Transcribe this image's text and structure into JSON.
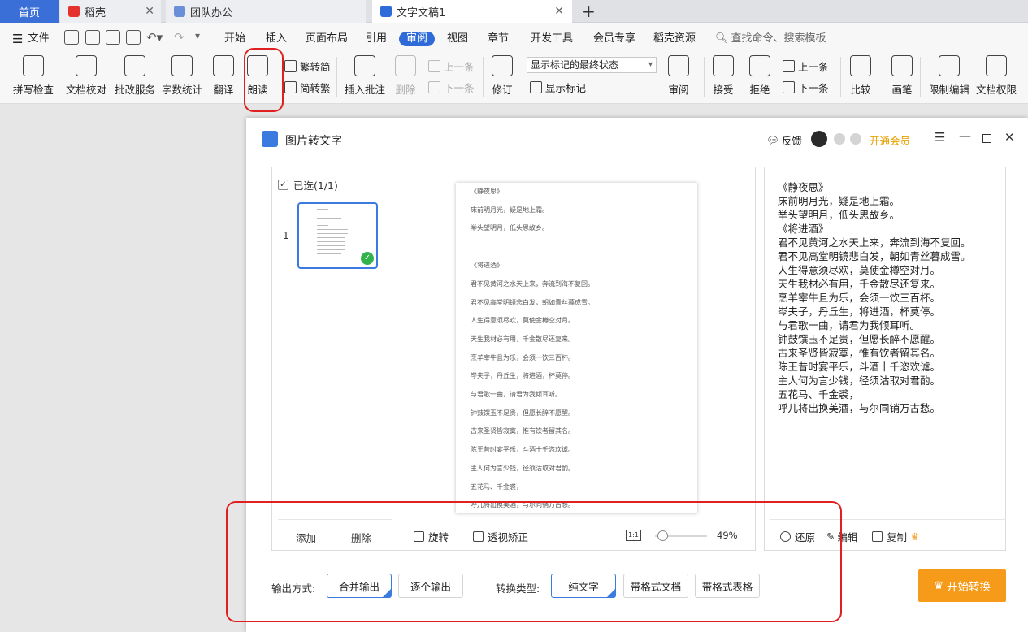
{
  "tabs": [
    {
      "label": "首页"
    },
    {
      "label": "稻壳"
    },
    {
      "label": "团队办公"
    },
    {
      "label": "文字文稿1"
    }
  ],
  "menu": {
    "file": "文件",
    "items": [
      "开始",
      "插入",
      "页面布局",
      "引用",
      "审阅",
      "视图",
      "章节",
      "开发工具",
      "会员专享",
      "稻壳资源"
    ],
    "search_placeholder": "查找命令、搜索模板"
  },
  "ribbon": {
    "spell": "拼写检查",
    "doc_check": "文档校对",
    "revise_service": "批改服务",
    "word_count": "字数统计",
    "translate": "翻译",
    "read_aloud": "朗读",
    "trad_to_simp": "繁转简",
    "simp_to_trad": "简转繁",
    "insert_comment": "插入批注",
    "delete": "删除",
    "prev": "上一条",
    "next": "下一条",
    "revision": "修订",
    "markup_select": "显示标记的最终状态",
    "show_markup": "显示标记",
    "review": "审阅",
    "accept": "接受",
    "reject": "拒绝",
    "prev2": "上一条",
    "next2": "下一条",
    "compare": "比较",
    "pen": "画笔",
    "restrict_edit": "限制编辑",
    "doc_permission": "文档权限"
  },
  "dialog": {
    "title": "图片转文字",
    "feedback": "反馈",
    "member": "开通会员",
    "selected": "已选(1/1)",
    "page_no": "1",
    "add": "添加",
    "remove": "删除",
    "rotate": "旋转",
    "perspective": "透视矫正",
    "ratio": "1:1",
    "zoom": "49%",
    "zoom_fraction": 0.05,
    "restore": "还原",
    "edit": "编辑",
    "copy": "复制",
    "output_label": "输出方式:",
    "merge_output": "合并输出",
    "single_output": "逐个输出",
    "convert_label": "转换类型:",
    "plain_text": "纯文字",
    "formatted_doc": "带格式文档",
    "formatted_table": "带格式表格",
    "start": "开始转换"
  },
  "preview_lines": [
    "《静夜思》",
    "床前明月光，疑是地上霜。",
    "举头望明月，低头思故乡。",
    "",
    "《将进酒》",
    "君不见黄河之水天上来，奔流到海不复回。",
    "君不见高堂明镜悲白发，朝如青丝暮成雪。",
    "人生得意须尽欢，莫使金樽空对月。",
    "天生我材必有用，千金散尽还复来。",
    "烹羊宰牛且为乐，会须一饮三百杯。",
    "岑夫子，丹丘生，将进酒，杯莫停。",
    "与君歌一曲，请君为我倾耳听。",
    "钟鼓馔玉不足贵，但愿长醉不愿醒。",
    "古来圣贤皆寂寞，惟有饮者留其名。",
    "陈王昔时宴平乐，斗酒十千恣欢谑。",
    "主人何为言少钱，径须沽取对君酌。",
    "五花马、千金裘，",
    "呼儿将出换美酒，与尔同销万古愁。"
  ],
  "result_lines": [
    "《静夜思》",
    "床前明月光，疑是地上霜。",
    "举头望明月，低头思故乡。",
    "《将进酒》",
    "君不见黄河之水天上来，奔流到海不复回。",
    "君不见高堂明镜悲白发，朝如青丝暮成雪。",
    "人生得意须尽欢，莫使金樽空对月。",
    "天生我材必有用，千金散尽还复来。",
    "烹羊宰牛且为乐，会须一饮三百杯。",
    "岑夫子，丹丘生，将进酒，杯莫停。",
    "与君歌一曲，请君为我倾耳听。",
    "钟鼓馔玉不足贵，但愿长醉不愿醒。",
    "古来圣贤皆寂寞，惟有饮者留其名。",
    "陈王昔时宴平乐，斗酒十千恣欢谑。",
    "主人何为言少钱，径须沽取对君酌。",
    "五花马、千金裘，",
    "呼儿将出换美酒，与尔同销万古愁。"
  ],
  "colors": {
    "accent": "#3b7be0",
    "start_button": "#f59a19",
    "member": "#e6a100",
    "highlight": "#e02020"
  }
}
